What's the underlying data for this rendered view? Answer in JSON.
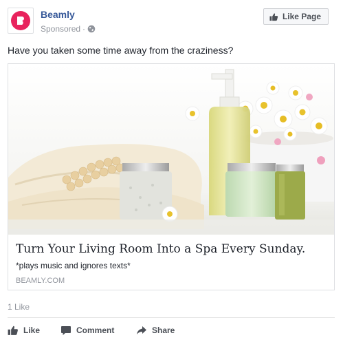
{
  "app": {
    "accent_color": "#365899",
    "brand_color": "#e8235d"
  },
  "post": {
    "page_name": "Beamly",
    "sponsored_label": "Sponsored",
    "separator": "·",
    "audience_icon": "globe-icon",
    "like_page_label": "Like Page",
    "text": "Have you taken some time away from the craziness?"
  },
  "card": {
    "image_description_icon": "spa-products-photo",
    "title": "Turn Your Living Room Into a Spa Every Sunday.",
    "description": "*plays music and ignores texts*",
    "domain": "BEAMLY.COM"
  },
  "reactions": {
    "likes_text": "1 Like"
  },
  "actions": {
    "like_label": "Like",
    "comment_label": "Comment",
    "share_label": "Share"
  }
}
